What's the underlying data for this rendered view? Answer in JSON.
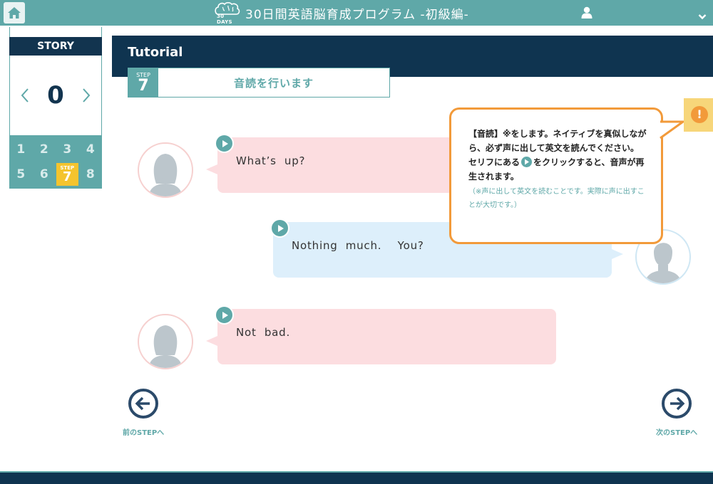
{
  "app": {
    "title": "30日間英語脳育成プログラム -初級編-",
    "logo_text": "30 DAYS"
  },
  "sidebar": {
    "story_label": "STORY",
    "story_number": "0",
    "steps": [
      {
        "label": "1"
      },
      {
        "label": "2"
      },
      {
        "label": "3"
      },
      {
        "label": "4"
      },
      {
        "label": "5"
      },
      {
        "label": "6"
      },
      {
        "label": "7",
        "tag": "STEP",
        "active": true
      },
      {
        "label": "8"
      }
    ]
  },
  "header": {
    "title": "Tutorial",
    "step_tag": "STEP",
    "step_number": "7",
    "step_title": "音読を行います"
  },
  "dialogue": [
    {
      "speaker": "female",
      "text": "What’s  up?"
    },
    {
      "speaker": "male",
      "text": "Nothing  much.    You?"
    },
    {
      "speaker": "female",
      "text": "Not  bad."
    }
  ],
  "tooltip": {
    "line1": "【音読】※をします。ネイティブを真似しながら、必ず声に出して英文を読んでください。",
    "line2a": "セリフにある",
    "line2b": "をクリックすると、音声が再生されます。",
    "note": "（※声に出して英文を読むことです。実際に声に出すことが大切です。）"
  },
  "alert": {
    "symbol": "!"
  },
  "nav": {
    "prev_label": "前のSTEPへ",
    "next_label": "次のSTEPへ"
  },
  "colors": {
    "teal": "#5fa8a8",
    "navy": "#0f3450",
    "accent_yellow": "#f4c42e",
    "tooltip_border": "#f29a3a"
  }
}
